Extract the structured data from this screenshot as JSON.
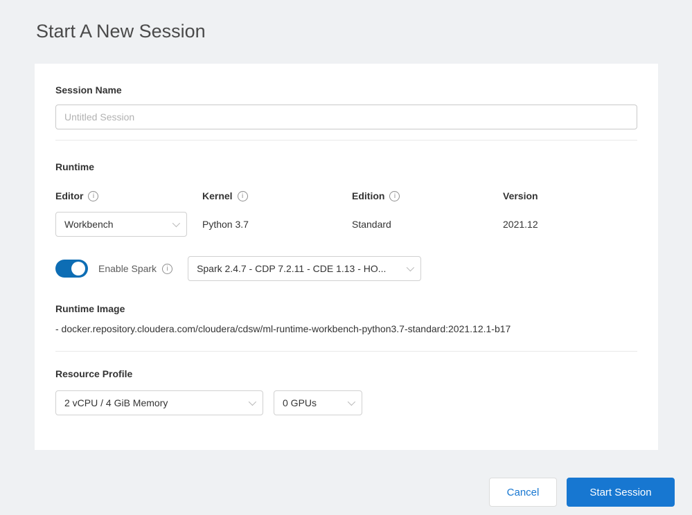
{
  "page": {
    "title": "Start A New Session"
  },
  "icons": {
    "info_glyph": "i"
  },
  "form": {
    "session_name": {
      "label": "Session Name",
      "placeholder": "Untitled Session",
      "value": ""
    },
    "runtime": {
      "section_label": "Runtime",
      "columns": [
        {
          "label": "Editor",
          "value": "Workbench"
        },
        {
          "label": "Kernel",
          "value": "Python 3.7"
        },
        {
          "label": "Edition",
          "value": "Standard"
        },
        {
          "label": "Version",
          "value": "2021.12"
        }
      ],
      "spark": {
        "toggle_label": "Enable Spark",
        "enabled": true,
        "version_selected": "Spark 2.4.7 - CDP 7.2.11 - CDE 1.13 - HO..."
      },
      "image": {
        "label": "Runtime Image",
        "value": "- docker.repository.cloudera.com/cloudera/cdsw/ml-runtime-workbench-python3.7-standard:2021.12.1-b17"
      }
    },
    "resource_profile": {
      "label": "Resource Profile",
      "cpu_memory_selected": "2 vCPU / 4 GiB Memory",
      "gpu_selected": "0 GPUs"
    }
  },
  "footer": {
    "cancel_label": "Cancel",
    "start_label": "Start Session"
  },
  "colors": {
    "primary_blue": "#1777d1",
    "toggle_blue": "#0d6db4",
    "page_background": "#eff1f3"
  }
}
